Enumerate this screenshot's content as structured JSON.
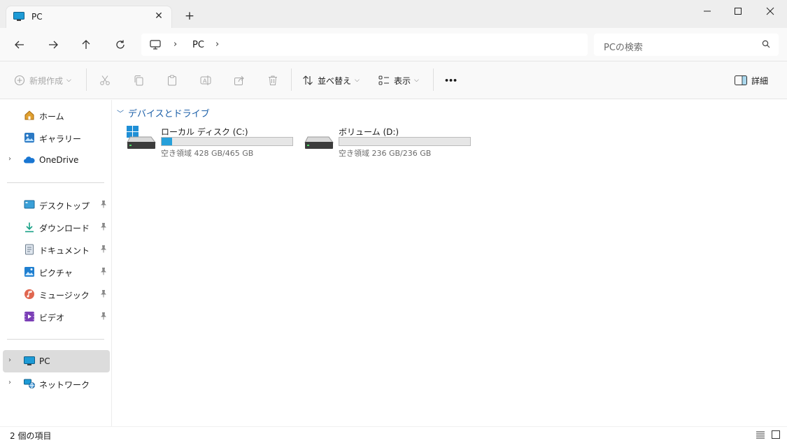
{
  "window": {
    "tab_title": "PC",
    "new_tab_label": "+"
  },
  "address_bar": {
    "breadcrumb": [
      "PC"
    ],
    "separator": "›",
    "search_placeholder": "PCの検索"
  },
  "command_bar": {
    "new_label": "新規作成",
    "sort_label": "並べ替え",
    "view_label": "表示",
    "more_label": "•••",
    "details_label": "詳細"
  },
  "sidebar": {
    "top_items": [
      {
        "label": "ホーム",
        "icon": "home-icon"
      },
      {
        "label": "ギャラリー",
        "icon": "gallery-icon"
      },
      {
        "label": "OneDrive",
        "icon": "onedrive-icon"
      }
    ],
    "quick_access": [
      {
        "label": "デスクトップ",
        "icon": "desktop-icon"
      },
      {
        "label": "ダウンロード",
        "icon": "download-icon"
      },
      {
        "label": "ドキュメント",
        "icon": "documents-icon"
      },
      {
        "label": "ピクチャ",
        "icon": "pictures-icon"
      },
      {
        "label": "ミュージック",
        "icon": "music-icon"
      },
      {
        "label": "ビデオ",
        "icon": "videos-icon"
      }
    ],
    "locations": [
      {
        "label": "PC",
        "icon": "pc-icon",
        "selected": true
      },
      {
        "label": "ネットワーク",
        "icon": "network-icon",
        "selected": false
      }
    ]
  },
  "content": {
    "group_title": "デバイスとドライブ",
    "drives": [
      {
        "name": "ローカル ディスク (C:)",
        "free_text": "空き領域 428 GB/465 GB",
        "free_gb": 428,
        "total_gb": 465,
        "used_fraction": 0.08
      },
      {
        "name": "ボリューム (D:)",
        "free_text": "空き領域 236 GB/236 GB",
        "free_gb": 236,
        "total_gb": 236,
        "used_fraction": 0.0
      }
    ]
  },
  "status_bar": {
    "item_count": "2 個の項目"
  },
  "colors": {
    "accent": "#26a0da",
    "group_header": "#1c5fa8",
    "selected_bg": "#dcdcdc"
  }
}
